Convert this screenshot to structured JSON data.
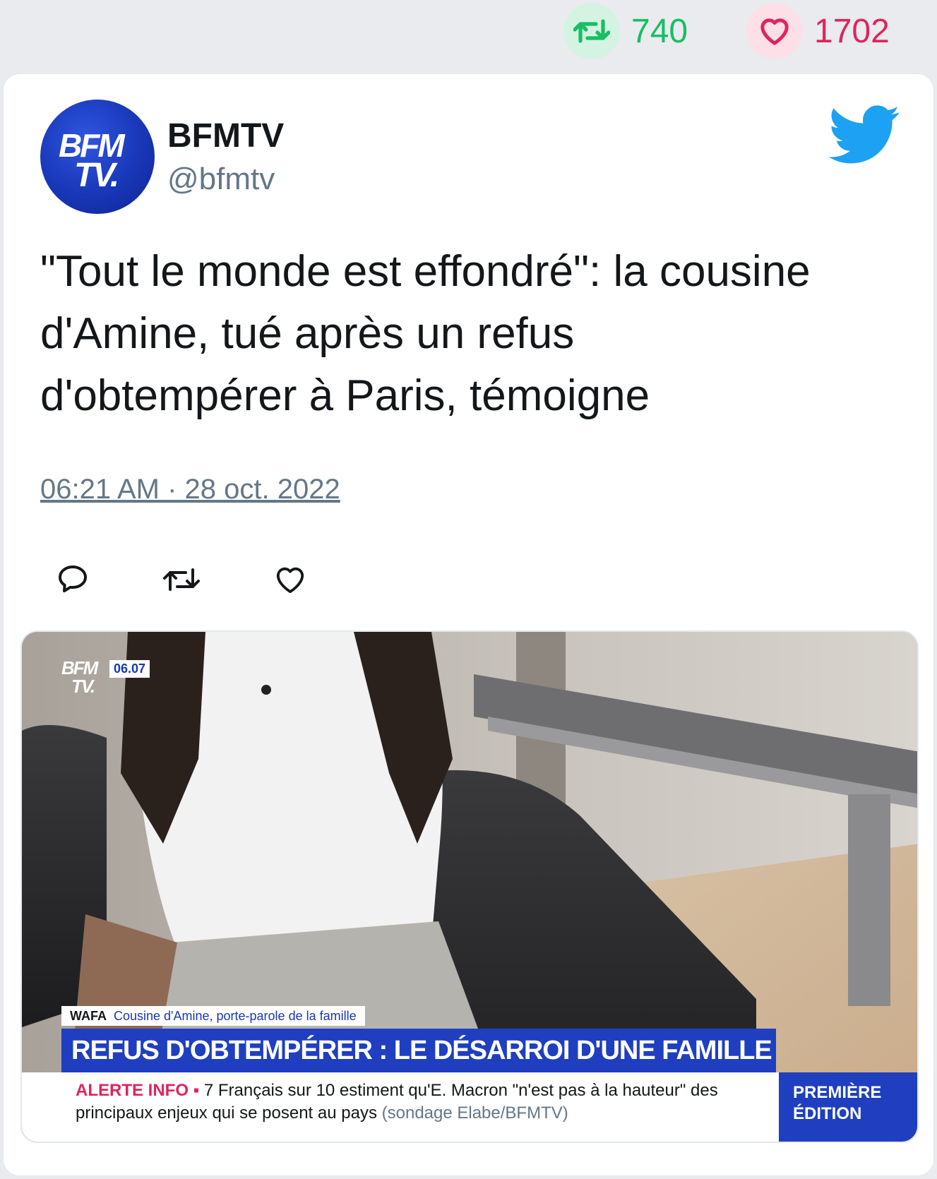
{
  "stats": {
    "retweets": "740",
    "likes": "1702",
    "retweet_color": "#17bf63",
    "like_color": "#e0245e",
    "retweet_icon": "retweet-icon",
    "like_icon": "heart-icon"
  },
  "author": {
    "avatar_line1": "BFM",
    "avatar_line2": "TV.",
    "name": "BFMTV",
    "handle": "@bfmtv",
    "brand_icon": "twitter-bird-icon",
    "brand_color": "#1da1f2"
  },
  "tweet": {
    "text": "\"Tout le monde est effondré\": la cousine\nd'Amine, tué après un refus\nd'obtempérer à Paris, témoigne",
    "timestamp": "06:21 AM · 28 oct. 2022"
  },
  "actions": [
    {
      "icon": "reply-icon"
    },
    {
      "icon": "retweet-icon"
    },
    {
      "icon": "like-icon"
    }
  ],
  "media": {
    "logo_line1": "BFM",
    "logo_line2": "TV.",
    "time": "06.07",
    "speaker_name": "WAFA",
    "speaker_role": "Cousine d'Amine, porte-parole de la famille",
    "headline": "REFUS D'OBTEMPÉRER : LE DÉSARROI D'UNE FAMILLE",
    "ticker_tag": "ALERTE INFO ▪",
    "ticker_text": "7 Français sur 10 estiment qu'E. Macron \"n'est pas à la hauteur\" des principaux enjeux qui se posent au pays",
    "ticker_source": "(sondage Elabe/BFMTV)",
    "edition_line1": "PREMIÈRE",
    "edition_line2": "ÉDITION"
  }
}
